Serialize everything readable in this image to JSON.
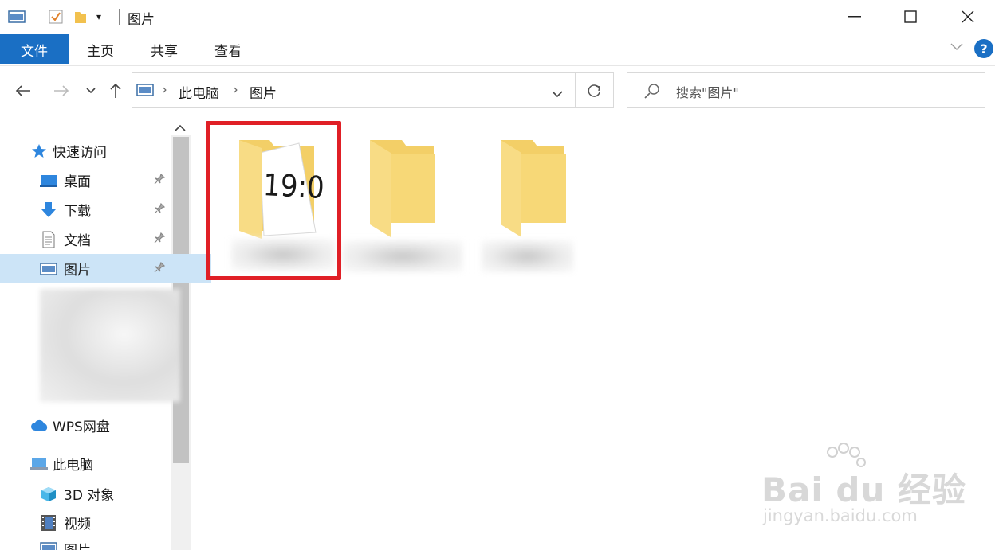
{
  "window": {
    "title": "图片"
  },
  "ribbon": {
    "tabs": [
      "文件",
      "主页",
      "共享",
      "查看"
    ]
  },
  "address": {
    "parts": [
      "此电脑",
      "图片"
    ]
  },
  "search": {
    "placeholder": "搜索\"图片\""
  },
  "sidebar": {
    "quick_access": "快速访问",
    "items": [
      {
        "label": "桌面",
        "icon": "desktop-icon",
        "pinned": true
      },
      {
        "label": "下载",
        "icon": "download-icon",
        "pinned": true
      },
      {
        "label": "文档",
        "icon": "document-icon",
        "pinned": true
      },
      {
        "label": "图片",
        "icon": "pictures-icon",
        "pinned": true,
        "selected": true
      }
    ],
    "wps": "WPS网盘",
    "this_pc": "此电脑",
    "pc_items": [
      {
        "label": "3D 对象",
        "icon": "3d-objects-icon"
      },
      {
        "label": "视频",
        "icon": "video-icon"
      },
      {
        "label": "图片",
        "icon": "pictures-icon"
      }
    ]
  },
  "content": {
    "folders": [
      {
        "thumb_text": "19:0",
        "highlighted": true
      },
      {
        "thumb_text": ""
      },
      {
        "thumb_text": ""
      }
    ]
  },
  "watermark": {
    "line1": "Bai du 经验",
    "line2": "jingyan.baidu.com"
  },
  "colors": {
    "accent": "#1a6fc4",
    "highlight": "#e01f26",
    "selected": "#cce4f7",
    "folder": "#f6d776"
  }
}
